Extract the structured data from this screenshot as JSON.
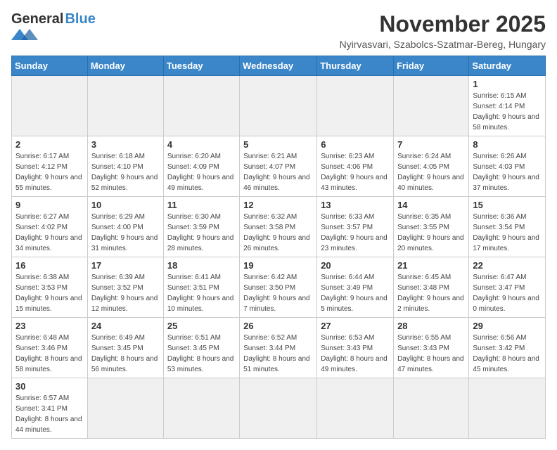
{
  "logo": {
    "general": "General",
    "blue": "Blue"
  },
  "header": {
    "month": "November 2025",
    "location": "Nyirvasvari, Szabolcs-Szatmar-Bereg, Hungary"
  },
  "weekdays": [
    "Sunday",
    "Monday",
    "Tuesday",
    "Wednesday",
    "Thursday",
    "Friday",
    "Saturday"
  ],
  "days": {
    "d1": {
      "num": "1",
      "sunrise": "Sunrise: 6:15 AM",
      "sunset": "Sunset: 4:14 PM",
      "daylight": "Daylight: 9 hours and 58 minutes."
    },
    "d2": {
      "num": "2",
      "sunrise": "Sunrise: 6:17 AM",
      "sunset": "Sunset: 4:12 PM",
      "daylight": "Daylight: 9 hours and 55 minutes."
    },
    "d3": {
      "num": "3",
      "sunrise": "Sunrise: 6:18 AM",
      "sunset": "Sunset: 4:10 PM",
      "daylight": "Daylight: 9 hours and 52 minutes."
    },
    "d4": {
      "num": "4",
      "sunrise": "Sunrise: 6:20 AM",
      "sunset": "Sunset: 4:09 PM",
      "daylight": "Daylight: 9 hours and 49 minutes."
    },
    "d5": {
      "num": "5",
      "sunrise": "Sunrise: 6:21 AM",
      "sunset": "Sunset: 4:07 PM",
      "daylight": "Daylight: 9 hours and 46 minutes."
    },
    "d6": {
      "num": "6",
      "sunrise": "Sunrise: 6:23 AM",
      "sunset": "Sunset: 4:06 PM",
      "daylight": "Daylight: 9 hours and 43 minutes."
    },
    "d7": {
      "num": "7",
      "sunrise": "Sunrise: 6:24 AM",
      "sunset": "Sunset: 4:05 PM",
      "daylight": "Daylight: 9 hours and 40 minutes."
    },
    "d8": {
      "num": "8",
      "sunrise": "Sunrise: 6:26 AM",
      "sunset": "Sunset: 4:03 PM",
      "daylight": "Daylight: 9 hours and 37 minutes."
    },
    "d9": {
      "num": "9",
      "sunrise": "Sunrise: 6:27 AM",
      "sunset": "Sunset: 4:02 PM",
      "daylight": "Daylight: 9 hours and 34 minutes."
    },
    "d10": {
      "num": "10",
      "sunrise": "Sunrise: 6:29 AM",
      "sunset": "Sunset: 4:00 PM",
      "daylight": "Daylight: 9 hours and 31 minutes."
    },
    "d11": {
      "num": "11",
      "sunrise": "Sunrise: 6:30 AM",
      "sunset": "Sunset: 3:59 PM",
      "daylight": "Daylight: 9 hours and 28 minutes."
    },
    "d12": {
      "num": "12",
      "sunrise": "Sunrise: 6:32 AM",
      "sunset": "Sunset: 3:58 PM",
      "daylight": "Daylight: 9 hours and 26 minutes."
    },
    "d13": {
      "num": "13",
      "sunrise": "Sunrise: 6:33 AM",
      "sunset": "Sunset: 3:57 PM",
      "daylight": "Daylight: 9 hours and 23 minutes."
    },
    "d14": {
      "num": "14",
      "sunrise": "Sunrise: 6:35 AM",
      "sunset": "Sunset: 3:55 PM",
      "daylight": "Daylight: 9 hours and 20 minutes."
    },
    "d15": {
      "num": "15",
      "sunrise": "Sunrise: 6:36 AM",
      "sunset": "Sunset: 3:54 PM",
      "daylight": "Daylight: 9 hours and 17 minutes."
    },
    "d16": {
      "num": "16",
      "sunrise": "Sunrise: 6:38 AM",
      "sunset": "Sunset: 3:53 PM",
      "daylight": "Daylight: 9 hours and 15 minutes."
    },
    "d17": {
      "num": "17",
      "sunrise": "Sunrise: 6:39 AM",
      "sunset": "Sunset: 3:52 PM",
      "daylight": "Daylight: 9 hours and 12 minutes."
    },
    "d18": {
      "num": "18",
      "sunrise": "Sunrise: 6:41 AM",
      "sunset": "Sunset: 3:51 PM",
      "daylight": "Daylight: 9 hours and 10 minutes."
    },
    "d19": {
      "num": "19",
      "sunrise": "Sunrise: 6:42 AM",
      "sunset": "Sunset: 3:50 PM",
      "daylight": "Daylight: 9 hours and 7 minutes."
    },
    "d20": {
      "num": "20",
      "sunrise": "Sunrise: 6:44 AM",
      "sunset": "Sunset: 3:49 PM",
      "daylight": "Daylight: 9 hours and 5 minutes."
    },
    "d21": {
      "num": "21",
      "sunrise": "Sunrise: 6:45 AM",
      "sunset": "Sunset: 3:48 PM",
      "daylight": "Daylight: 9 hours and 2 minutes."
    },
    "d22": {
      "num": "22",
      "sunrise": "Sunrise: 6:47 AM",
      "sunset": "Sunset: 3:47 PM",
      "daylight": "Daylight: 9 hours and 0 minutes."
    },
    "d23": {
      "num": "23",
      "sunrise": "Sunrise: 6:48 AM",
      "sunset": "Sunset: 3:46 PM",
      "daylight": "Daylight: 8 hours and 58 minutes."
    },
    "d24": {
      "num": "24",
      "sunrise": "Sunrise: 6:49 AM",
      "sunset": "Sunset: 3:45 PM",
      "daylight": "Daylight: 8 hours and 56 minutes."
    },
    "d25": {
      "num": "25",
      "sunrise": "Sunrise: 6:51 AM",
      "sunset": "Sunset: 3:45 PM",
      "daylight": "Daylight: 8 hours and 53 minutes."
    },
    "d26": {
      "num": "26",
      "sunrise": "Sunrise: 6:52 AM",
      "sunset": "Sunset: 3:44 PM",
      "daylight": "Daylight: 8 hours and 51 minutes."
    },
    "d27": {
      "num": "27",
      "sunrise": "Sunrise: 6:53 AM",
      "sunset": "Sunset: 3:43 PM",
      "daylight": "Daylight: 8 hours and 49 minutes."
    },
    "d28": {
      "num": "28",
      "sunrise": "Sunrise: 6:55 AM",
      "sunset": "Sunset: 3:43 PM",
      "daylight": "Daylight: 8 hours and 47 minutes."
    },
    "d29": {
      "num": "29",
      "sunrise": "Sunrise: 6:56 AM",
      "sunset": "Sunset: 3:42 PM",
      "daylight": "Daylight: 8 hours and 45 minutes."
    },
    "d30": {
      "num": "30",
      "sunrise": "Sunrise: 6:57 AM",
      "sunset": "Sunset: 3:41 PM",
      "daylight": "Daylight: 8 hours and 44 minutes."
    }
  }
}
